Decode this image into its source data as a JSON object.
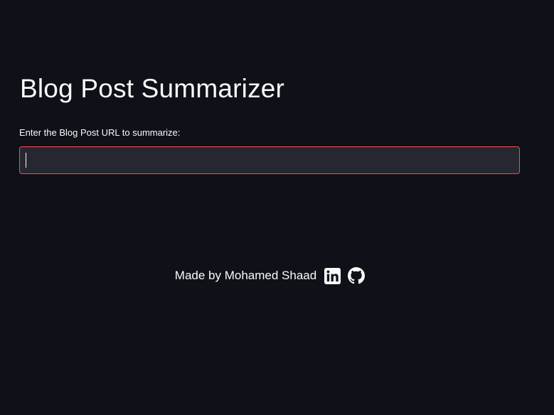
{
  "app": {
    "title": "Blog Post Summarizer"
  },
  "form": {
    "url_label": "Enter the Blog Post URL to summarize:",
    "url_value": "",
    "url_placeholder": ""
  },
  "footer": {
    "made_by": "Made by Mohamed Shaad",
    "links": [
      {
        "icon": "linkedin-icon"
      },
      {
        "icon": "github-icon"
      }
    ]
  },
  "colors": {
    "background": "#0e1117",
    "input_background": "#262730",
    "focus_border": "#ff4b4b",
    "text": "#fafafa"
  }
}
